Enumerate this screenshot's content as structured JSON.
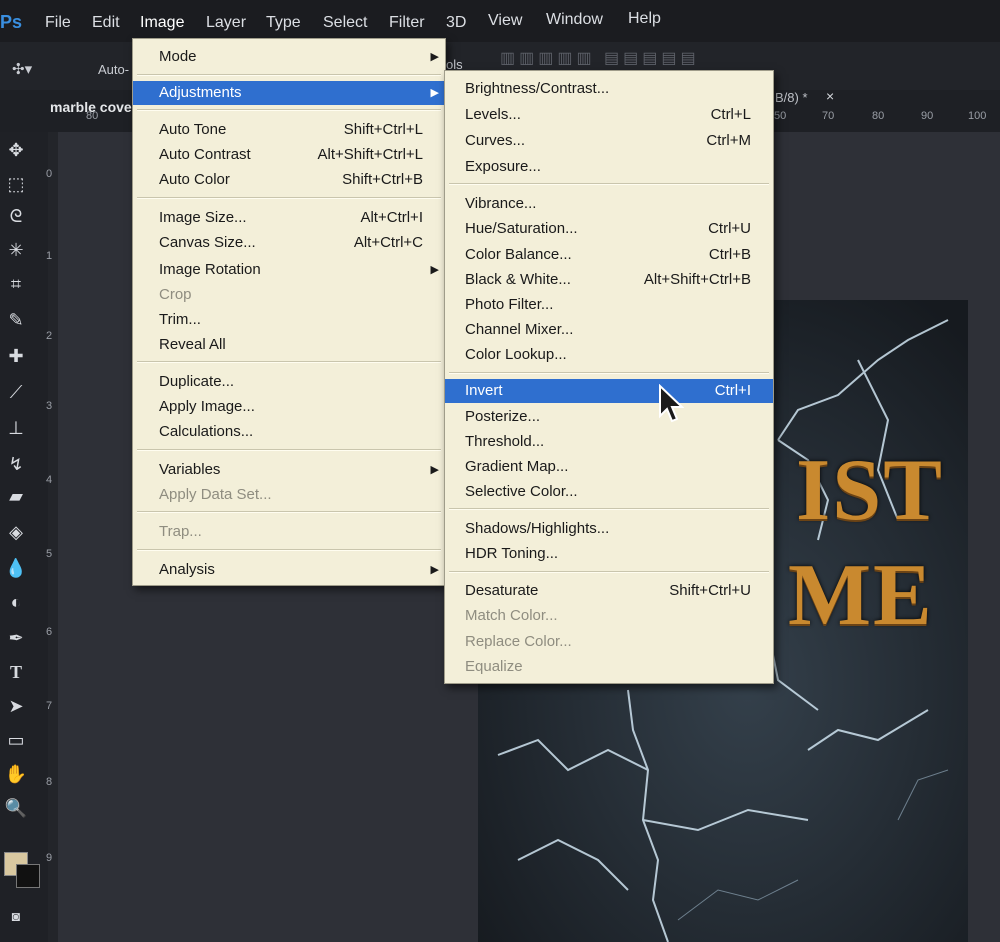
{
  "menubar": {
    "logo": "Ps",
    "items": [
      "File",
      "Edit",
      "Image",
      "Layer",
      "Type",
      "Select",
      "Filter",
      "3D",
      "View",
      "Window",
      "Help"
    ]
  },
  "optionsbar": {
    "auto_select": "Auto-",
    "trailing": "ols"
  },
  "document": {
    "tab_title": "marble cove",
    "tab_suffix": "B/8) *",
    "close": "×",
    "ruler_top": [
      "80",
      "50",
      "70",
      "80",
      "90",
      "100"
    ],
    "ruler_left": [
      "0",
      "1",
      "2",
      "3",
      "4",
      "5",
      "6",
      "7",
      "8",
      "9"
    ]
  },
  "artwork": {
    "line1": "IST",
    "line2": "ME"
  },
  "image_menu": {
    "items": [
      {
        "label": "Mode",
        "shortcut": "",
        "submenu": true
      },
      {
        "label": "Adjustments",
        "shortcut": "",
        "submenu": true,
        "highlighted": true
      },
      {
        "label": "Auto Tone",
        "shortcut": "Shift+Ctrl+L"
      },
      {
        "label": "Auto Contrast",
        "shortcut": "Alt+Shift+Ctrl+L"
      },
      {
        "label": "Auto Color",
        "shortcut": "Shift+Ctrl+B"
      },
      {
        "label": "Image Size...",
        "shortcut": "Alt+Ctrl+I"
      },
      {
        "label": "Canvas Size...",
        "shortcut": "Alt+Ctrl+C"
      },
      {
        "label": "Image Rotation",
        "shortcut": "",
        "submenu": true
      },
      {
        "label": "Crop",
        "shortcut": "",
        "disabled": true
      },
      {
        "label": "Trim...",
        "shortcut": ""
      },
      {
        "label": "Reveal All",
        "shortcut": ""
      },
      {
        "label": "Duplicate...",
        "shortcut": ""
      },
      {
        "label": "Apply Image...",
        "shortcut": ""
      },
      {
        "label": "Calculations...",
        "shortcut": ""
      },
      {
        "label": "Variables",
        "shortcut": "",
        "submenu": true
      },
      {
        "label": "Apply Data Set...",
        "shortcut": "",
        "disabled": true
      },
      {
        "label": "Trap...",
        "shortcut": "",
        "disabled": true
      },
      {
        "label": "Analysis",
        "shortcut": "",
        "submenu": true
      }
    ]
  },
  "adjust_menu": {
    "items": [
      {
        "label": "Brightness/Contrast...",
        "shortcut": ""
      },
      {
        "label": "Levels...",
        "shortcut": "Ctrl+L"
      },
      {
        "label": "Curves...",
        "shortcut": "Ctrl+M"
      },
      {
        "label": "Exposure...",
        "shortcut": ""
      },
      {
        "label": "Vibrance...",
        "shortcut": ""
      },
      {
        "label": "Hue/Saturation...",
        "shortcut": "Ctrl+U"
      },
      {
        "label": "Color Balance...",
        "shortcut": "Ctrl+B"
      },
      {
        "label": "Black & White...",
        "shortcut": "Alt+Shift+Ctrl+B"
      },
      {
        "label": "Photo Filter...",
        "shortcut": ""
      },
      {
        "label": "Channel Mixer...",
        "shortcut": ""
      },
      {
        "label": "Color Lookup...",
        "shortcut": ""
      },
      {
        "label": "Invert",
        "shortcut": "Ctrl+I",
        "highlighted": true
      },
      {
        "label": "Posterize...",
        "shortcut": ""
      },
      {
        "label": "Threshold...",
        "shortcut": ""
      },
      {
        "label": "Gradient Map...",
        "shortcut": ""
      },
      {
        "label": "Selective Color...",
        "shortcut": ""
      },
      {
        "label": "Shadows/Highlights...",
        "shortcut": ""
      },
      {
        "label": "HDR Toning...",
        "shortcut": ""
      },
      {
        "label": "Desaturate",
        "shortcut": "Shift+Ctrl+U"
      },
      {
        "label": "Match Color...",
        "shortcut": "",
        "disabled": true
      },
      {
        "label": "Replace Color...",
        "shortcut": "",
        "disabled": true
      },
      {
        "label": "Equalize",
        "shortcut": "",
        "disabled": true
      }
    ]
  },
  "colors": {
    "menu_bg": "#f3efd9",
    "highlight": "#2f6fcf",
    "title_gold": "#c9892f"
  }
}
